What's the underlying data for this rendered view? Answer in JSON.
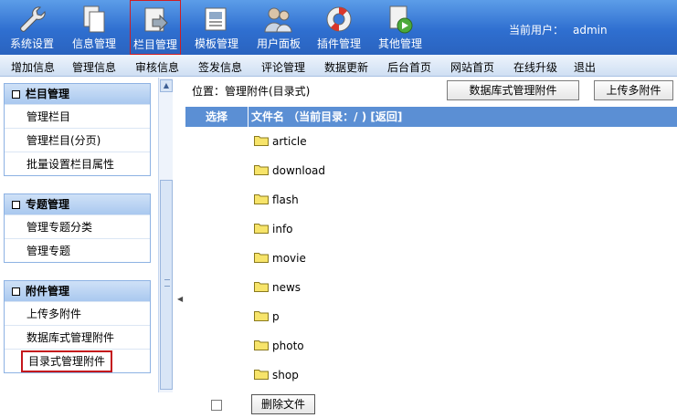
{
  "toolbar": {
    "items": [
      {
        "label": "系统设置",
        "icon": "wrench-icon"
      },
      {
        "label": "信息管理",
        "icon": "documents-icon"
      },
      {
        "label": "栏目管理",
        "icon": "column-edit-icon",
        "active": true
      },
      {
        "label": "模板管理",
        "icon": "template-icon"
      },
      {
        "label": "用户面板",
        "icon": "users-icon"
      },
      {
        "label": "插件管理",
        "icon": "lifebuoy-icon"
      },
      {
        "label": "其他管理",
        "icon": "play-doc-icon"
      }
    ],
    "current_user_label": "当前用户：",
    "current_user": "admin"
  },
  "submenu": [
    "增加信息",
    "管理信息",
    "审核信息",
    "签发信息",
    "评论管理",
    "数据更新",
    "后台首页",
    "网站首页",
    "在线升级",
    "退出"
  ],
  "sidebar": {
    "groups": [
      {
        "title": "栏目管理",
        "items": [
          "管理栏目",
          "管理栏目(分页)",
          "批量设置栏目属性"
        ]
      },
      {
        "title": "专题管理",
        "items": [
          "管理专题分类",
          "管理专题"
        ]
      },
      {
        "title": "附件管理",
        "items": [
          "上传多附件",
          "数据库式管理附件",
          "目录式管理附件"
        ]
      }
    ]
  },
  "main": {
    "location": "位置：管理附件(目录式)",
    "btn_db": "数据库式管理附件",
    "btn_upload": "上传多附件",
    "col_select": "选择",
    "col_file": "文件名 （当前目录：/ ) [返回]",
    "folders": [
      "article",
      "download",
      "flash",
      "info",
      "movie",
      "news",
      "p",
      "photo",
      "shop"
    ],
    "delete_button": "删除文件"
  },
  "colors": {
    "toolbar": "#3a7ad8",
    "header": "#5b8fd4",
    "highlight": "#c4161c"
  }
}
